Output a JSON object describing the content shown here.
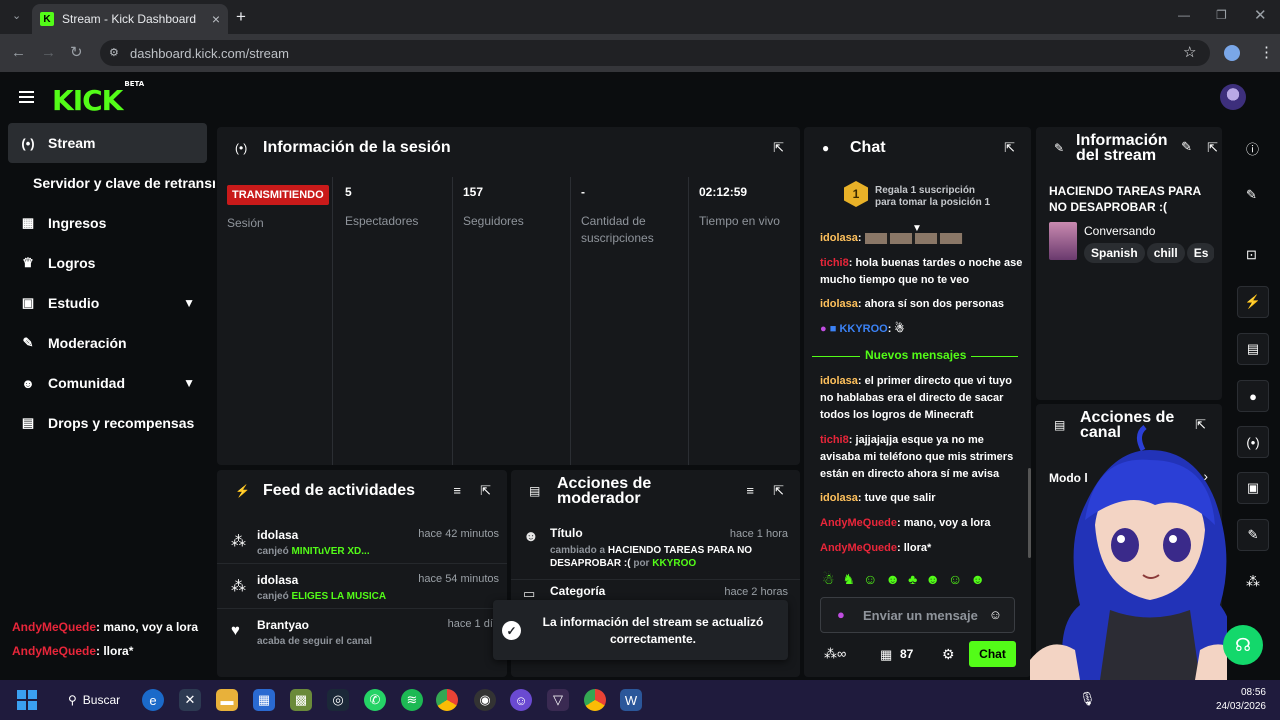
{
  "browser": {
    "tab_title": "Stream - Kick Dashboard",
    "tab_favicon": "K",
    "url": "dashboard.kick.com/stream",
    "new_tab": "+",
    "close_tab": "×"
  },
  "header": {
    "logo": "KICK",
    "logo_badge": "BETA"
  },
  "sidebar": {
    "items": [
      {
        "label": "Stream",
        "icon": "broadcast-icon"
      },
      {
        "label": "Servidor y clave de retransmisión",
        "icon": ""
      },
      {
        "label": "Ingresos",
        "icon": "chart-icon"
      },
      {
        "label": "Logros",
        "icon": "trophy-icon"
      },
      {
        "label": "Estudio",
        "icon": "video-icon"
      },
      {
        "label": "Moderación",
        "icon": "wrench-icon"
      },
      {
        "label": "Comunidad",
        "icon": "community-icon"
      },
      {
        "label": "Drops y recompensas",
        "icon": "drops-icon"
      }
    ],
    "overlay_chat": [
      {
        "user": "AndyMeQuede",
        "text": ": mano, voy a lora"
      },
      {
        "user": "AndyMeQuede",
        "text": ": llora*"
      }
    ]
  },
  "session": {
    "title": "Información de la sesión",
    "status_badge": "TRANSMITIENDO",
    "status_label": "Sesión",
    "stats": [
      {
        "value": "5",
        "label": "Espectadores"
      },
      {
        "value": "157",
        "label": "Seguidores"
      },
      {
        "value": "-",
        "label": "Cantidad de suscripciones"
      },
      {
        "value": "02:12:59",
        "label": "Tiempo en vivo"
      }
    ]
  },
  "feed": {
    "title": "Feed de actividades",
    "items": [
      {
        "user": "idolasa",
        "time": "hace 42 minutos",
        "action": "canjeó ",
        "detail": "MINITuVER XD..."
      },
      {
        "user": "idolasa",
        "time": "hace 54 minutos",
        "action": "canjeó ",
        "detail": "ELIGES LA MUSICA"
      },
      {
        "user": "Brantyao",
        "time": "hace 1 día",
        "action": "acaba de seguir el canal",
        "detail": ""
      }
    ]
  },
  "modactions": {
    "title_line1": "Acciones de",
    "title_line2": "moderador",
    "items": [
      {
        "title": "Título",
        "time": "hace 1 hora",
        "desc_prefix": "cambiado a ",
        "desc_value": "HACIENDO TAREAS PARA NO DESAPROBAR :(",
        "by": " por ",
        "by_user": "KKYROO"
      },
      {
        "title": "Categoría",
        "time": "hace 2 horas"
      }
    ],
    "toast": "La información del stream se actualizó correctamente."
  },
  "chat": {
    "title": "Chat",
    "gift_rank": "1",
    "gift_line1": "Regala 1 suscripción",
    "gift_line2": "para tomar la posición 1",
    "messages": [
      {
        "user": "idolasa",
        "text": ":"
      },
      {
        "user": "tichi8",
        "text": ": hola buenas tardes o noche ase mucho tiempo que no te veo"
      },
      {
        "user": "idolasa",
        "text": ": ahora sí son dos personas"
      },
      {
        "user": "KKYROO",
        "text": ":"
      },
      {
        "user": "idolasa",
        "text": ": el primer directo que vi tuyo no hablabas era el directo de sacar todos los logros de Minecraft"
      },
      {
        "user": "tichi8",
        "text": ": jajjajajja esque ya no me avisaba mi teléfono que mis strimers están en directo ahora sí me avisa"
      },
      {
        "user": "idolasa",
        "text": ": tuve que salir"
      },
      {
        "user": "AndyMeQuede",
        "text": ": mano, voy a lora"
      },
      {
        "user": "AndyMeQuede",
        "text": ": llora*"
      }
    ],
    "new_messages": "Nuevos mensajes",
    "input_placeholder": "Enviar un mensaje",
    "points": "87",
    "send_label": "Chat"
  },
  "streaminfo": {
    "title_line1": "Información",
    "title_line2": "del stream",
    "stream_title": "HACIENDO TAREAS PARA NO DESAPROBAR :(",
    "category": "Conversando",
    "tags": [
      "Spanish",
      "chill",
      "Es"
    ]
  },
  "channelactions": {
    "title_line1": "Acciones de",
    "title_line2": "canal",
    "item": "Modo l"
  },
  "taskbar": {
    "search": "Buscar",
    "time": "08:56",
    "date": "24/03/2026"
  },
  "colors": {
    "kick_green": "#53fc18",
    "live_red": "#c91a1a",
    "user_gold": "#ffc15c",
    "user_red": "#e8263a"
  }
}
